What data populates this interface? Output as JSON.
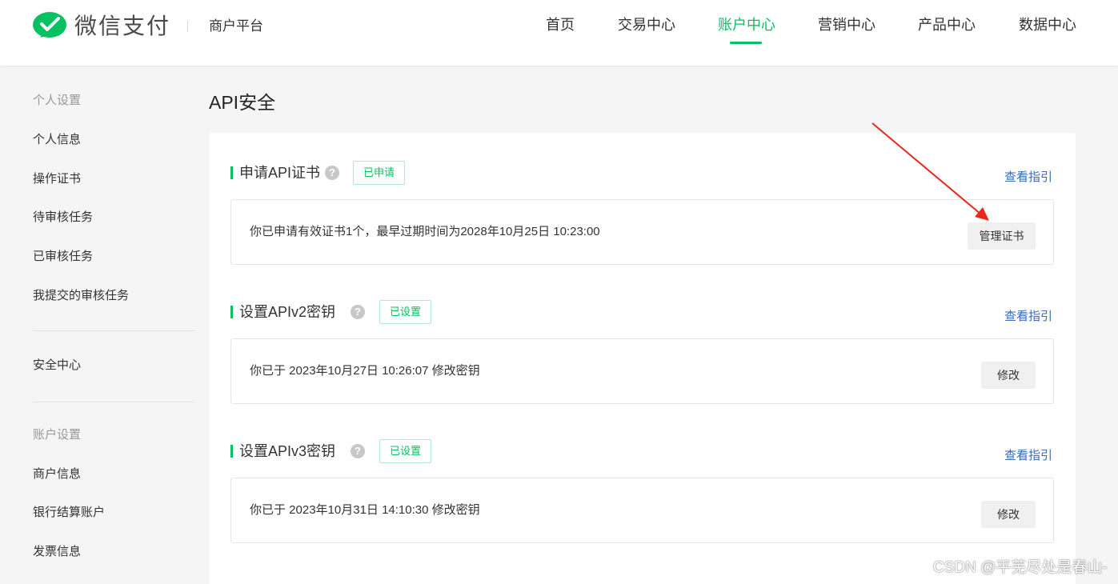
{
  "header": {
    "brand": "微信支付",
    "platform": "商户平台",
    "nav": [
      "首页",
      "交易中心",
      "账户中心",
      "营销中心",
      "产品中心",
      "数据中心"
    ],
    "active_nav": "账户中心",
    "accent_color": "#07c160"
  },
  "sidebar": {
    "group1_title": "个人设置",
    "group1_items": [
      "个人信息",
      "操作证书",
      "待审核任务",
      "已审核任务",
      "我提交的审核任务"
    ],
    "security_item": "安全中心",
    "group2_title": "账户设置",
    "group2_items": [
      "商户信息",
      "银行结算账户",
      "发票信息"
    ]
  },
  "main": {
    "title": "API安全",
    "sections": [
      {
        "title": "申请API证书",
        "badge": "已申请",
        "guide": "查看指引",
        "info": "你已申请有效证书1个，最早过期时间为2028年10月25日 10:23:00",
        "button": "管理证书"
      },
      {
        "title": "设置APIv2密钥",
        "badge": "已设置",
        "guide": "查看指引",
        "info": "你已于 2023年10月27日 10:26:07 修改密钥",
        "button": "修改"
      },
      {
        "title": "设置APIv3密钥",
        "badge": "已设置",
        "guide": "查看指引",
        "info": "你已于 2023年10月31日 14:10:30 修改密钥",
        "button": "修改"
      }
    ]
  },
  "icons": {
    "logo": "wechat-pay-logo-icon",
    "help": "question-mark-icon",
    "help_glyph": "?",
    "annotation": "red-arrow-annotation"
  },
  "watermark": "CSDN @平芜尽处是春山-"
}
